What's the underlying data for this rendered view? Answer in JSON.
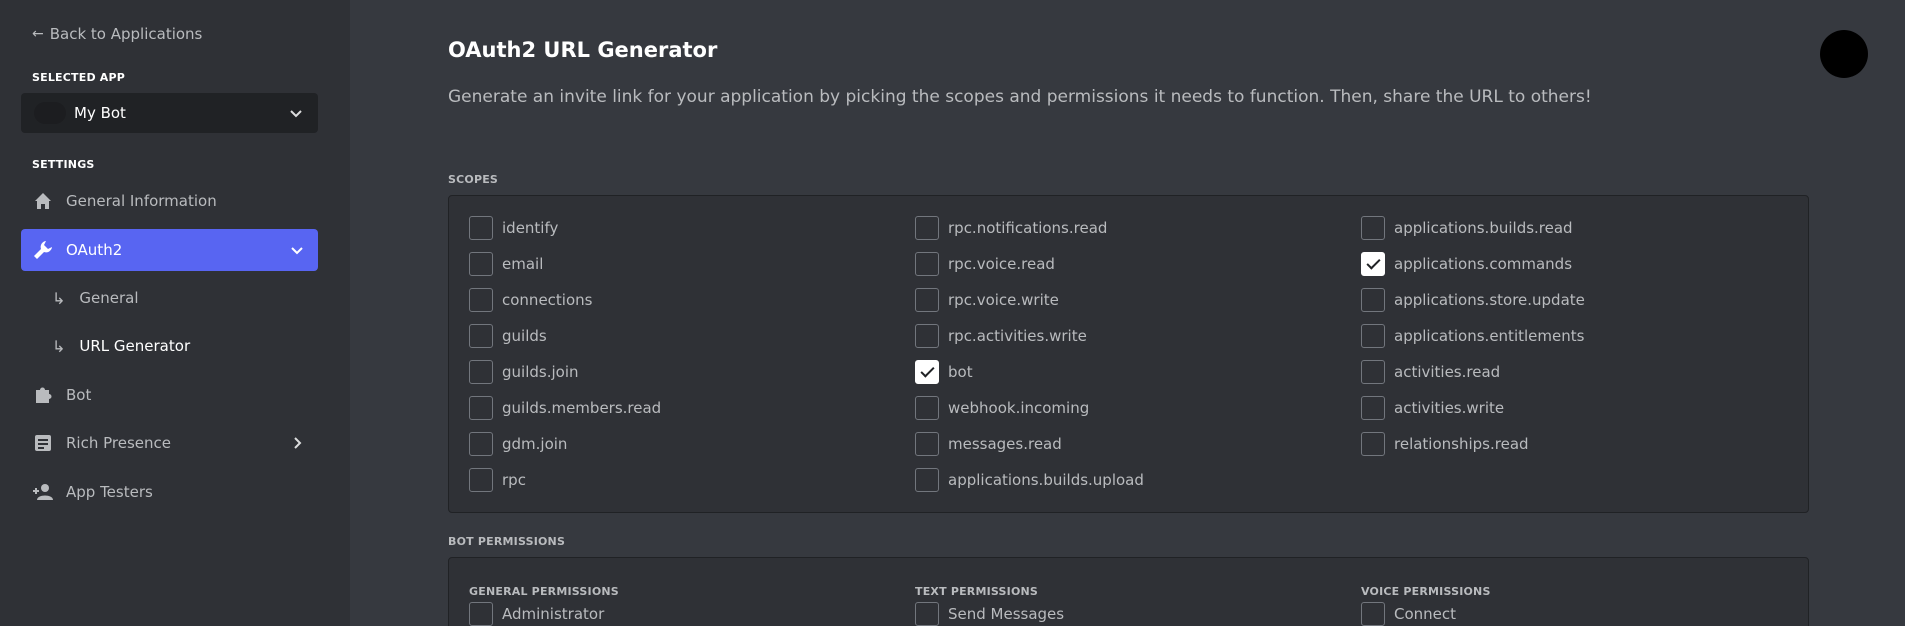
{
  "sidebar": {
    "back_label": "Back to Applications",
    "selected_app_label": "SELECTED APP",
    "selected_app_name": "My Bot",
    "settings_label": "SETTINGS",
    "items": [
      {
        "label": "General Information",
        "icon": "home-icon"
      },
      {
        "label": "OAuth2",
        "icon": "wrench-icon",
        "active": true
      },
      {
        "label": "Bot",
        "icon": "puzzle-icon"
      },
      {
        "label": "Rich Presence",
        "icon": "document-icon"
      },
      {
        "label": "App Testers",
        "icon": "person-add-icon"
      }
    ],
    "subitems": [
      {
        "label": "General"
      },
      {
        "label": "URL Generator",
        "current": true
      }
    ]
  },
  "main": {
    "title": "OAuth2 URL Generator",
    "description": "Generate an invite link for your application by picking the scopes and permissions it needs to function. Then, share the URL to others!",
    "scopes_label": "SCOPES",
    "scopes": {
      "col1": [
        {
          "label": "identify",
          "checked": false
        },
        {
          "label": "email",
          "checked": false
        },
        {
          "label": "connections",
          "checked": false
        },
        {
          "label": "guilds",
          "checked": false
        },
        {
          "label": "guilds.join",
          "checked": false
        },
        {
          "label": "guilds.members.read",
          "checked": false
        },
        {
          "label": "gdm.join",
          "checked": false
        },
        {
          "label": "rpc",
          "checked": false
        }
      ],
      "col2": [
        {
          "label": "rpc.notifications.read",
          "checked": false
        },
        {
          "label": "rpc.voice.read",
          "checked": false
        },
        {
          "label": "rpc.voice.write",
          "checked": false
        },
        {
          "label": "rpc.activities.write",
          "checked": false
        },
        {
          "label": "bot",
          "checked": true
        },
        {
          "label": "webhook.incoming",
          "checked": false
        },
        {
          "label": "messages.read",
          "checked": false
        },
        {
          "label": "applications.builds.upload",
          "checked": false
        }
      ],
      "col3": [
        {
          "label": "applications.builds.read",
          "checked": false
        },
        {
          "label": "applications.commands",
          "checked": true
        },
        {
          "label": "applications.store.update",
          "checked": false
        },
        {
          "label": "applications.entitlements",
          "checked": false
        },
        {
          "label": "activities.read",
          "checked": false
        },
        {
          "label": "activities.write",
          "checked": false
        },
        {
          "label": "relationships.read",
          "checked": false
        }
      ]
    },
    "bot_permissions_label": "BOT PERMISSIONS",
    "permission_groups": [
      {
        "label": "GENERAL PERMISSIONS",
        "first_item": "Administrator"
      },
      {
        "label": "TEXT PERMISSIONS",
        "first_item": "Send Messages"
      },
      {
        "label": "VOICE PERMISSIONS",
        "first_item": "Connect"
      }
    ]
  },
  "colors": {
    "accent": "#5865f2",
    "sidebar_bg": "#2f3136",
    "main_bg": "#36393f"
  }
}
